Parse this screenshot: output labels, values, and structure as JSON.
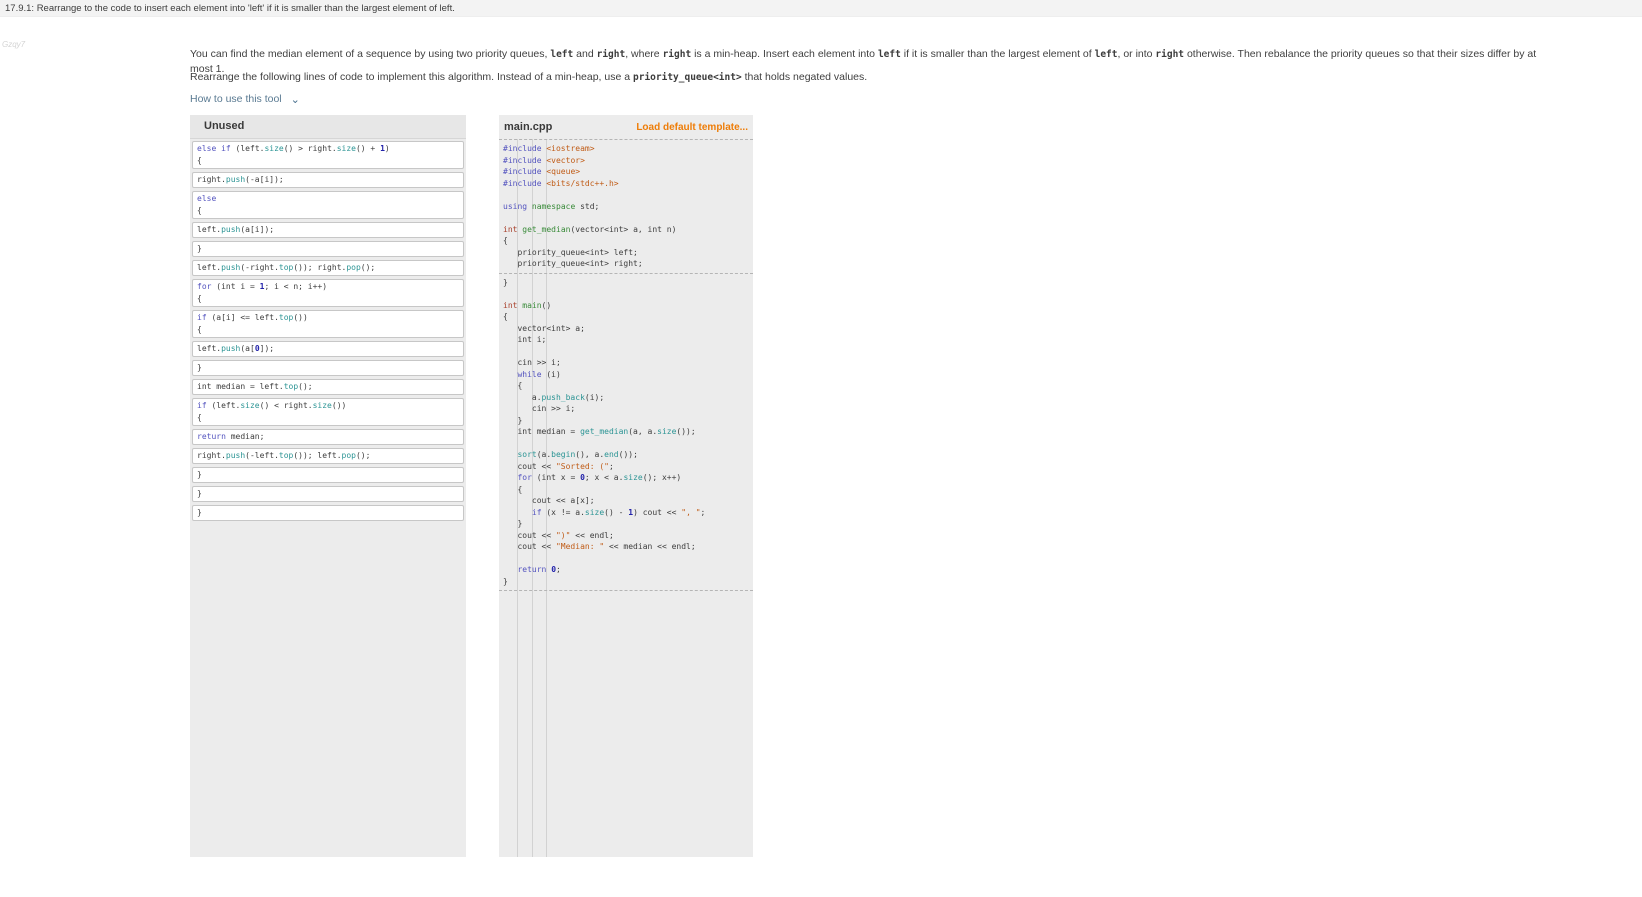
{
  "page": {
    "title": "17.9.1: Rearrange to the code to insert each element into 'left' if it is smaller than the largest element of left.",
    "watermark": "Gzqy7"
  },
  "intro": {
    "p1": [
      {
        "t": "You can find the median element of a sequence by using two priority queues, "
      },
      {
        "t": "left",
        "mono": true
      },
      {
        "t": " and "
      },
      {
        "t": "right",
        "mono": true
      },
      {
        "t": ", where "
      },
      {
        "t": "right",
        "mono": true
      },
      {
        "t": " is a min-heap. Insert each element into "
      },
      {
        "t": "left",
        "mono": true
      },
      {
        "t": " if it is smaller than the largest element of "
      },
      {
        "t": "left",
        "mono": true
      },
      {
        "t": ", or into "
      },
      {
        "t": "right",
        "mono": true
      },
      {
        "t": " otherwise. Then rebalance the priority queues so that their sizes differ by at most 1."
      }
    ],
    "p2": [
      {
        "t": "Rearrange the following lines of code to implement this algorithm. Instead of a min-heap, use a "
      },
      {
        "t": "priority_queue<int>",
        "mono": true
      },
      {
        "t": " that holds negated values."
      }
    ],
    "help_toggle": "How to use this tool",
    "chevron_icon": "⌄"
  },
  "unused_panel": {
    "title": "Unused",
    "blocks": [
      [
        "else if (left.size() > right.size() + 1)",
        "{"
      ],
      [
        "right.push(-a[i]);"
      ],
      [
        "else",
        "{"
      ],
      [
        "left.push(a[i]);"
      ],
      [
        "}"
      ],
      [
        "left.push(-right.top()); right.pop();"
      ],
      [
        "for (int i = 1; i < n; i++)",
        "{"
      ],
      [
        "if (a[i] <= left.top())",
        "{"
      ],
      [
        "left.push(a[0]);"
      ],
      [
        "}"
      ],
      [
        "int median = left.top();"
      ],
      [
        "if (left.size() < right.size())",
        "{"
      ],
      [
        "return median;"
      ],
      [
        "right.push(-left.top()); left.pop();"
      ],
      [
        "}"
      ],
      [
        "}"
      ],
      [
        "}"
      ]
    ]
  },
  "editor_panel": {
    "title": "main.cpp",
    "load_template_label": "Load default template...",
    "code_sections": [
      {
        "lines": [
          "#include <iostream>",
          "#include <vector>",
          "#include <queue>",
          "#include <bits/stdc++.h>",
          "",
          "using namespace std;",
          "",
          "int get_median(vector<int> a, int n)",
          "{",
          "   priority_queue<int> left;",
          "   priority_queue<int> right;"
        ]
      },
      {
        "lines": [
          "}",
          "",
          "int main()",
          "{",
          "   vector<int> a;",
          "   int i;",
          "",
          "   cin >> i;",
          "   while (i)",
          "   {",
          "      a.push_back(i);",
          "      cin >> i;",
          "   }",
          "   int median = get_median(a, a.size());",
          "",
          "   sort(a.begin(), a.end());",
          "   cout << \"Sorted: (\";",
          "   for (int x = 0; x < a.size(); x++)",
          "   {",
          "      cout << a[x];",
          "      if (x != a.size() - 1) cout << \", \";",
          "   }",
          "   cout << \")\" << endl;",
          "   cout << \"Median: \" << median << endl;",
          "",
          "   return 0;",
          "}"
        ]
      }
    ]
  },
  "colors": {
    "accent_orange": "#ee7d08",
    "panel_background": "#ececec",
    "keyword": "#5353bf",
    "method": "#2b9494",
    "string": "#c05c17",
    "function": "#388a38",
    "type": "#a8402c",
    "number": "#2222aa"
  }
}
